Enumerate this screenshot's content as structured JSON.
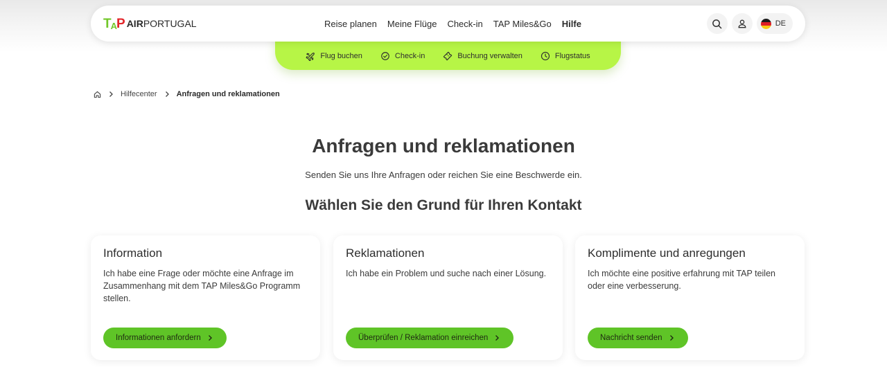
{
  "brand": {
    "mark_t": "T",
    "mark_a": "A",
    "mark_p": "P",
    "text_bold": "AIR",
    "text_light": "PORTUGAL"
  },
  "nav": [
    {
      "label": "Reise planen"
    },
    {
      "label": "Meine Flüge"
    },
    {
      "label": "Check-in"
    },
    {
      "label": "TAP Miles&Go"
    },
    {
      "label": "Hilfe"
    }
  ],
  "header_icons": {
    "search": "search-icon",
    "account": "user-icon"
  },
  "language": {
    "code": "DE",
    "flag": "germany-flag"
  },
  "subnav": [
    {
      "label": "Flug buchen",
      "icon": "plane-icon"
    },
    {
      "label": "Check-in",
      "icon": "check-circle-icon"
    },
    {
      "label": "Buchung verwalten",
      "icon": "ticket-icon"
    },
    {
      "label": "Flugstatus",
      "icon": "clock-icon"
    }
  ],
  "breadcrumb": {
    "home": "home-icon",
    "level1": "Hilfecenter",
    "current": "Anfragen und reklamationen"
  },
  "page": {
    "title": "Anfragen und reklamationen",
    "subtitle": "Senden Sie uns Ihre Anfragen oder reichen Sie eine Beschwerde ein.",
    "section_title": "Wählen Sie den Grund für Ihren Kontakt"
  },
  "cards": [
    {
      "title": "Information",
      "text": "Ich habe eine Frage oder möchte eine Anfrage im Zusammenhang mit dem TAP Miles&Go Programm stellen.",
      "button": "Informationen anfordern"
    },
    {
      "title": "Reklamationen",
      "text": "Ich habe ein Problem und suche nach einer Lösung.",
      "button": "Überprüfen / Reklamation einreichen"
    },
    {
      "title": "Komplimente und anregungen",
      "text": "Ich möchte eine positive erfahrung mit TAP teilen oder eine verbesserung.",
      "button": "Nachricht senden"
    }
  ],
  "colors": {
    "accent_green": "#5fc427",
    "subnav_green": "#b7f546",
    "logo_red": "#e3262b"
  }
}
